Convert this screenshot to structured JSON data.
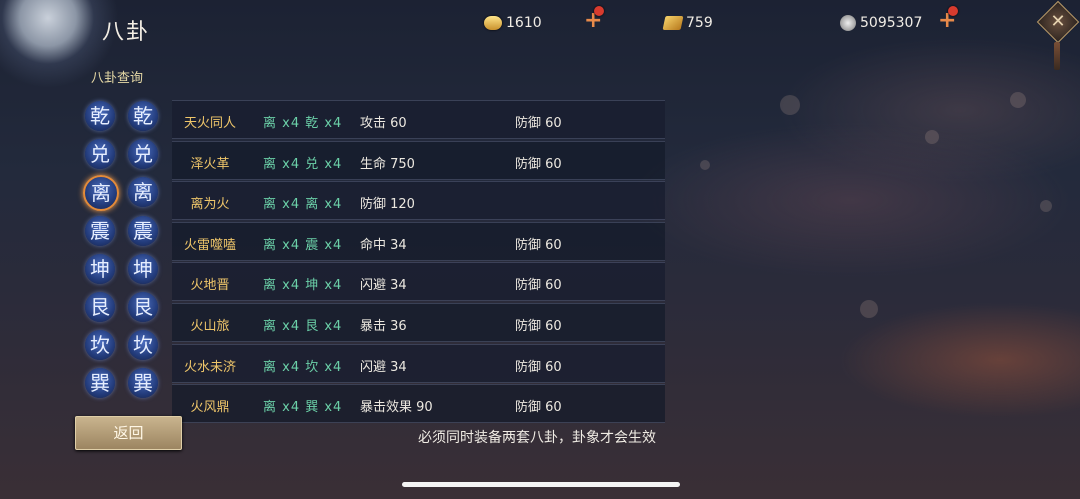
{
  "header": {
    "title": "八卦",
    "subtitle": "八卦查询"
  },
  "currencies": [
    {
      "icon": "gold-ingot-icon",
      "value": "1610",
      "has_plus": true,
      "has_alert": true
    },
    {
      "icon": "gold-bar-icon",
      "value": "759",
      "has_plus": false,
      "has_alert": false
    },
    {
      "icon": "copper-coin-icon",
      "value": "5095307",
      "has_plus": true,
      "has_alert": true
    }
  ],
  "trigrams": {
    "left": [
      "乾",
      "兑",
      "离",
      "震",
      "坤",
      "艮",
      "坎",
      "巽"
    ],
    "right": [
      "乾",
      "兑",
      "离",
      "震",
      "坤",
      "艮",
      "坎",
      "巽"
    ],
    "selected": "离"
  },
  "rows": [
    {
      "name": "天火同人",
      "req": "离 x4 乾 x4",
      "attr1": "攻击 60",
      "attr2": "防御 60"
    },
    {
      "name": "泽火革",
      "req": "离 x4 兑 x4",
      "attr1": "生命 750",
      "attr2": "防御 60"
    },
    {
      "name": "离为火",
      "req": "离 x4 离 x4",
      "attr1": "防御 120",
      "attr2": ""
    },
    {
      "name": "火雷噬嗑",
      "req": "离 x4 震 x4",
      "attr1": "命中 34",
      "attr2": "防御 60"
    },
    {
      "name": "火地晋",
      "req": "离 x4 坤 x4",
      "attr1": "闪避 34",
      "attr2": "防御 60"
    },
    {
      "name": "火山旅",
      "req": "离 x4 艮 x4",
      "attr1": "暴击 36",
      "attr2": "防御 60"
    },
    {
      "name": "火水未济",
      "req": "离 x4 坎 x4",
      "attr1": "闪避 34",
      "attr2": "防御 60"
    },
    {
      "name": "火风鼎",
      "req": "离 x4 巽 x4",
      "attr1": "暴击效果 90",
      "attr2": "防御 60"
    }
  ],
  "footer": {
    "back_label": "返回",
    "notice": "必须同时装备两套八卦，卦象才会生效"
  },
  "colors": {
    "accent_gold": "#efc66a",
    "requirement_green": "#6bd0a8",
    "alert_red": "#d83b2e"
  }
}
